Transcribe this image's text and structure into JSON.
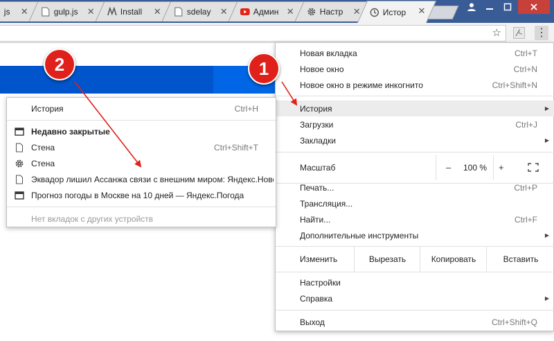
{
  "tabs": [
    {
      "title": "js"
    },
    {
      "title": "gulp.js"
    },
    {
      "title": "Install"
    },
    {
      "title": "sdelay"
    },
    {
      "title": "Админ"
    },
    {
      "title": "Настр"
    },
    {
      "title": "Истор"
    }
  ],
  "menu": {
    "new_tab": {
      "label": "Новая вкладка",
      "shortcut": "Ctrl+T"
    },
    "new_window": {
      "label": "Новое окно",
      "shortcut": "Ctrl+N"
    },
    "incognito": {
      "label": "Новое окно в режиме инкогнито",
      "shortcut": "Ctrl+Shift+N"
    },
    "history": {
      "label": "История"
    },
    "downloads": {
      "label": "Загрузки",
      "shortcut": "Ctrl+J"
    },
    "bookmarks": {
      "label": "Закладки"
    },
    "zoom": {
      "label": "Масштаб",
      "minus": "–",
      "value": "100 %",
      "plus": "+"
    },
    "print": {
      "label": "Печать...",
      "shortcut": "Ctrl+P"
    },
    "cast": {
      "label": "Трансляция..."
    },
    "find": {
      "label": "Найти...",
      "shortcut": "Ctrl+F"
    },
    "more_tools": {
      "label": "Дополнительные инструменты"
    },
    "edit": {
      "label": "Изменить",
      "cut": "Вырезать",
      "copy": "Копировать",
      "paste": "Вставить"
    },
    "settings": {
      "label": "Настройки"
    },
    "help": {
      "label": "Справка"
    },
    "exit": {
      "label": "Выход",
      "shortcut": "Ctrl+Shift+Q"
    }
  },
  "submenu": {
    "history": {
      "label": "История",
      "shortcut": "Ctrl+H"
    },
    "recently_closed": {
      "label": "Недавно закрытые"
    },
    "items": [
      {
        "label": "Стена",
        "shortcut": "Ctrl+Shift+T"
      },
      {
        "label": "Стена",
        "shortcut": ""
      },
      {
        "label": "Эквадор лишил Ассанжа связи с внешним миром: Яндекс.Новости",
        "shortcut": ""
      },
      {
        "label": "Прогноз погоды в Москве на 10 дней — Яндекс.Погода",
        "shortcut": ""
      }
    ],
    "no_tabs": "Нет вкладок с других устройств"
  },
  "badges": {
    "one": "1",
    "two": "2"
  },
  "colors": {
    "accent_red": "#e0201b",
    "page_blue": "#0055cc",
    "tabstrip": "#3a5c96"
  }
}
